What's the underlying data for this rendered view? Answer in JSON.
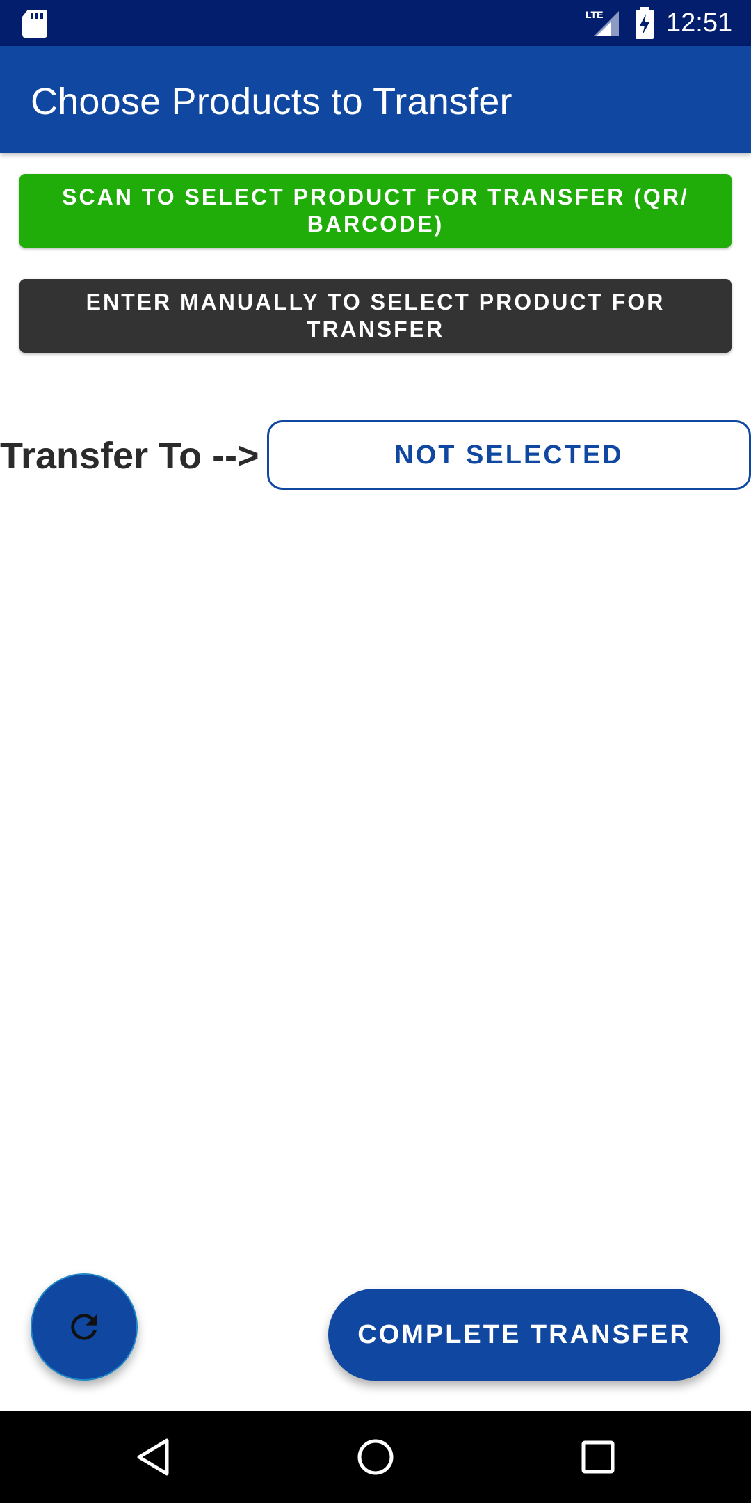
{
  "status_bar": {
    "time": "12:51",
    "network": "LTE",
    "icons": [
      "sd-card-icon",
      "lte-signal-icon",
      "battery-charging-icon"
    ]
  },
  "app_bar": {
    "title": "Choose Products to Transfer"
  },
  "actions": {
    "scan_label": "SCAN TO SELECT PRODUCT FOR TRANSFER (QR/ BARCODE)",
    "manual_label": "ENTER MANUALLY TO SELECT PRODUCT FOR TRANSFER"
  },
  "transfer": {
    "label": "Transfer To -->",
    "destination_value": "NOT SELECTED"
  },
  "footer": {
    "refresh_icon": "refresh-icon",
    "complete_label": "COMPLETE TRANSFER"
  },
  "nav_bar": {
    "icons": [
      "back-icon",
      "home-icon",
      "recent-apps-icon"
    ]
  },
  "colors": {
    "status_bar": "#041e6e",
    "primary": "#0f47a1",
    "scan_button": "#20ad09",
    "manual_button": "#333333"
  }
}
